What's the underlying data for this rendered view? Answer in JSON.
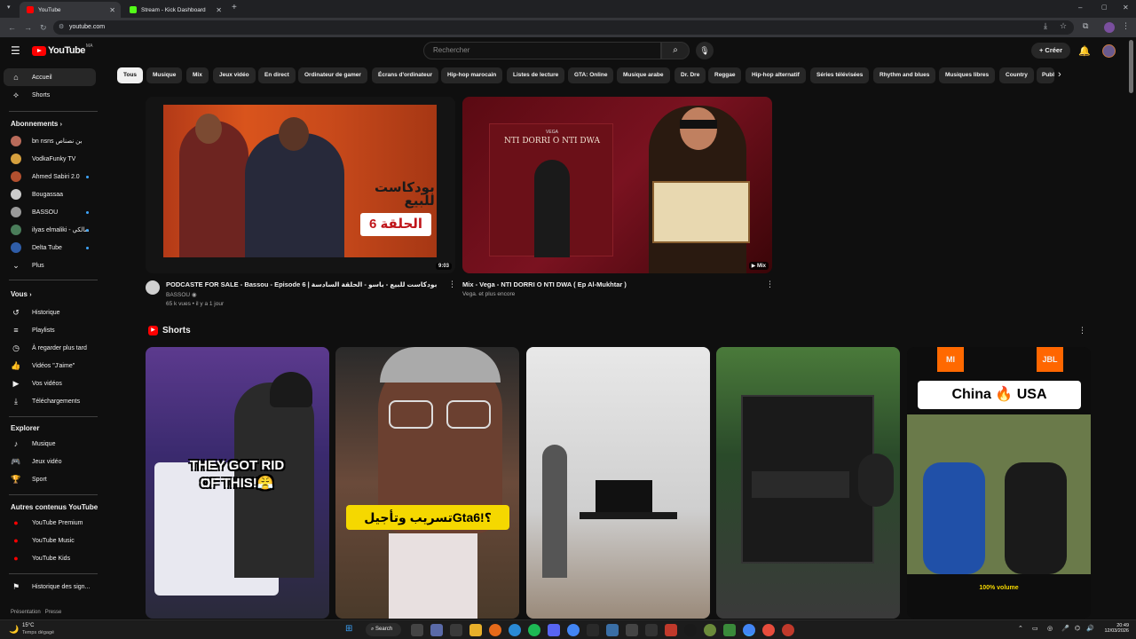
{
  "browser": {
    "tabs": [
      {
        "title": "YouTube",
        "active": true
      },
      {
        "title": "Stream - Kick Dashboard",
        "active": false
      }
    ],
    "url": "youtube.com"
  },
  "header": {
    "logo": "YouTube",
    "logo_sup": "MA",
    "search_placeholder": "Rechercher",
    "create_label": "Créer"
  },
  "sidebar": {
    "main": [
      {
        "label": "Accueil",
        "icon": "home-icon",
        "active": true
      },
      {
        "label": "Shorts",
        "icon": "shorts-icon"
      }
    ],
    "subs_title": "Abonnements",
    "subscriptions": [
      {
        "label": "bn nsns بن نصناص",
        "color": "#b96b5a",
        "dot": false
      },
      {
        "label": "VodkaFunky TV",
        "color": "#d6a03e",
        "dot": false
      },
      {
        "label": "Ahmed Sabiri 2.0",
        "color": "#b3502f",
        "dot": true
      },
      {
        "label": "Bougassaa",
        "color": "#cccccc",
        "dot": false
      },
      {
        "label": "BASSOU",
        "color": "#9a9a9a",
        "dot": true
      },
      {
        "label": "ilyas elmaliki - المالكي",
        "color": "#4a7d5a",
        "dot": true
      },
      {
        "label": "Delta Tube",
        "color": "#2f5da8",
        "dot": true
      }
    ],
    "more_label": "Plus",
    "you_title": "Vous",
    "you_items": [
      {
        "label": "Historique",
        "icon": "history-icon"
      },
      {
        "label": "Playlists",
        "icon": "playlist-icon"
      },
      {
        "label": "À regarder plus tard",
        "icon": "watch-later-icon"
      },
      {
        "label": "Vidéos \"J'aime\"",
        "icon": "like-icon"
      },
      {
        "label": "Vos vidéos",
        "icon": "your-videos-icon"
      },
      {
        "label": "Téléchargements",
        "icon": "download-icon"
      }
    ],
    "explore_title": "Explorer",
    "explore_items": [
      {
        "label": "Musique",
        "icon": "music-icon"
      },
      {
        "label": "Jeux vidéo",
        "icon": "gaming-icon"
      },
      {
        "label": "Sport",
        "icon": "trophy-icon"
      }
    ],
    "more_yt_title": "Autres contenus YouTube",
    "more_yt_items": [
      {
        "label": "YouTube Premium"
      },
      {
        "label": "YouTube Music"
      },
      {
        "label": "YouTube Kids"
      }
    ],
    "report_label": "Historique des sign...",
    "footer": "Présentation   Presse"
  },
  "chips": [
    "Tous",
    "Musique",
    "Mix",
    "Jeux vidéo",
    "En direct",
    "Ordinateur de gamer",
    "Écrans d'ordinateur",
    "Hip-hop marocain",
    "Listes de lecture",
    "GTA: Online",
    "Musique arabe",
    "Dr. Dre",
    "Reggae",
    "Hip-hop alternatif",
    "Séries télévisées",
    "Rhythm and blues",
    "Musiques libres",
    "Country",
    "Publ"
  ],
  "videos": [
    {
      "title": "PODCASTE FOR SALE - Bassou - Episode 6 | بودكاست للبيع - باسو - الحلقة السادسة",
      "channel": "BASSOU",
      "meta": "65 k vues • il y a 1 jour",
      "duration": "9:03",
      "overlay1": "بودكاست",
      "overlay2": "للبيع",
      "overlay3": "الحلقة 6"
    },
    {
      "title": "Mix - Vega - NTI DORRI O NTI DWA ( Ep Al-Mukhtar )",
      "channel": "Vega. et plus encore",
      "badge": "Mix",
      "cover_small": "VEGA",
      "cover_title": "NTI DORRI O NTI DWA"
    }
  ],
  "shorts_title": "Shorts",
  "shorts": [
    {
      "caption": "THEY GOT RID OF THIS!😤"
    },
    {
      "caption": "تسريب وتأجيلGta6!؟"
    },
    {
      "caption": ""
    },
    {
      "caption": ""
    },
    {
      "caption": "China 🔥 USA",
      "sub": "100% volume",
      "brand1": "MI",
      "brand2": "JBL"
    }
  ],
  "taskbar": {
    "weather_temp": "15°C",
    "weather_desc": "Temps dégagé",
    "search_label": "Search",
    "time": "20:49",
    "date": "12/03/2026"
  }
}
